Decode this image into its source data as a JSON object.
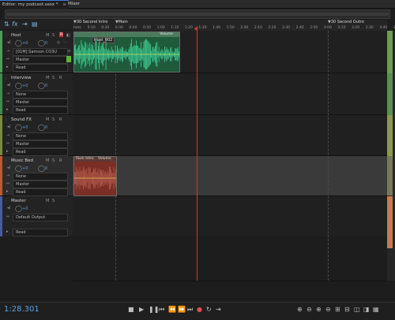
{
  "tabs": {
    "editor": "Editor: my podcast.sesx *",
    "mixer": "Mixer"
  },
  "ruler": {
    "markers": {
      "m1": "30 Second Intro",
      "m2": "Main",
      "m3": "30 Second Outro"
    },
    "ticks": [
      "hms",
      "0:10",
      "0:20",
      "0:30",
      "0:40",
      "0:50",
      "1:00",
      "1:10",
      "1:20",
      "1:30",
      "1:40",
      "1:50",
      "2:00",
      "2:10",
      "2:20",
      "2:30",
      "2:40",
      "2:50",
      "3:00",
      "3:10",
      "3:20",
      "3:30",
      "3:40",
      "3:50"
    ]
  },
  "tracks": {
    "host": {
      "name": "Host",
      "vol": "+0",
      "input": "[01M] Samson CO3U",
      "output": "Master",
      "read": "Read",
      "color": "#4aa05a",
      "m": "M",
      "s": "S",
      "r": "R"
    },
    "interview": {
      "name": "Interview",
      "vol": "+0",
      "input": "None",
      "output": "Master",
      "read": "Read",
      "color": "#3f8a4f",
      "m": "M",
      "s": "S",
      "r": "R"
    },
    "soundfx": {
      "name": "Sound FX",
      "vol": "+0",
      "input": "None",
      "output": "Master",
      "read": "Read",
      "color": "#7b8a3a",
      "m": "M",
      "s": "S",
      "r": "R"
    },
    "musicbed": {
      "name": "Music Bed",
      "vol": "+0",
      "input": "None",
      "output": "Master",
      "read": "Read",
      "color": "#c05a2a",
      "m": "M",
      "s": "S",
      "r": "R"
    },
    "master": {
      "name": "Master",
      "vol": "+0",
      "output": "Default Output",
      "read": "Read",
      "color": "#4a5aa0"
    }
  },
  "clips": {
    "host": {
      "name": "Host_002",
      "label": "Volume"
    },
    "music": {
      "name": "Rock Intro",
      "label": "Volume"
    }
  },
  "transport": {
    "timecode": "1:28.301"
  }
}
